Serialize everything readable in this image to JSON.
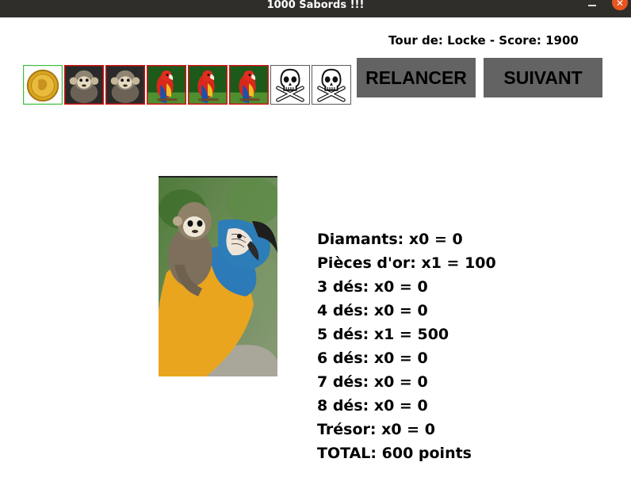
{
  "window": {
    "title": "1000 Sabords !!!"
  },
  "turn_info": "Tour de: Locke - Score: 1900",
  "dice": [
    {
      "face": "coin-icon",
      "border": "#3fbf3f"
    },
    {
      "face": "monkey-icon",
      "border": "#d21414"
    },
    {
      "face": "monkey-icon",
      "border": "#d21414"
    },
    {
      "face": "parrot-icon",
      "border": "#d21414"
    },
    {
      "face": "parrot-icon",
      "border": "#d21414"
    },
    {
      "face": "parrot-icon",
      "border": "#d21414"
    },
    {
      "face": "skull-icon",
      "border": "#555555"
    },
    {
      "face": "skull-icon",
      "border": "#555555"
    }
  ],
  "buttons": {
    "reroll": "RELANCER",
    "next": "SUIVANT"
  },
  "card": {
    "image": "monkey-and-parrot-card"
  },
  "score_lines": [
    "Diamants: x0 = 0",
    "Pièces d'or: x1 = 100",
    "3 dés: x0 = 0",
    "4 dés: x0 = 0",
    "5 dés: x1 = 500",
    "6 dés: x0 = 0",
    "7 dés: x0 = 0",
    "8 dés: x0 = 0",
    "Trésor: x0 = 0",
    "TOTAL: 600 points"
  ]
}
